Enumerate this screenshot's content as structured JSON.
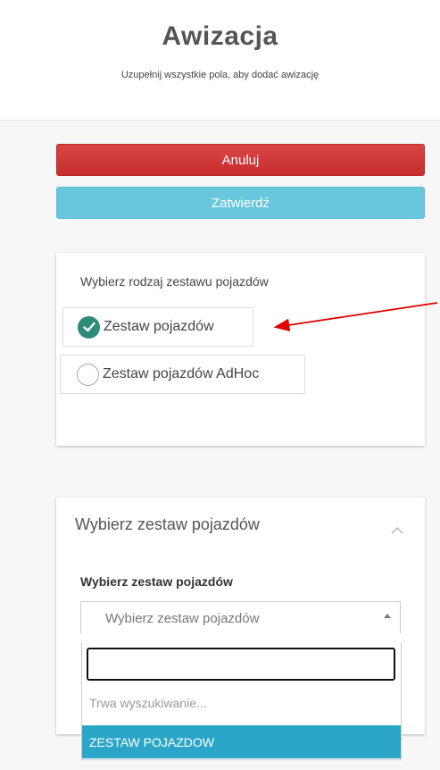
{
  "header": {
    "title": "Awizacja",
    "subtitle": "Uzupełnij wszystkie pola, aby dodać awizację"
  },
  "buttons": {
    "cancel_label": "Anuluj",
    "confirm_label": "Zatwierdź"
  },
  "vehicle_type": {
    "label": "Wybierz rodzaj zestawu pojazdów",
    "options": [
      {
        "label": "Zestaw pojazdów",
        "selected": true
      },
      {
        "label": "Zestaw pojazdów AdHoc",
        "selected": false
      }
    ]
  },
  "vehicle_set": {
    "panel_title": "Wybierz zestaw pojazdów",
    "field_label": "Wybierz zestaw pojazdów",
    "select_placeholder": "Wybierz zestaw pojazdów",
    "dropdown": {
      "search_value": "",
      "status_text": "Trwa wyszukiwanie...",
      "options": [
        "ZESTAW POJAZDOW"
      ]
    }
  },
  "colors": {
    "cancel": "#c72e2e",
    "confirm": "#68c7dc",
    "check": "#2e8b7a",
    "highlight": "#2ba6c9",
    "annotation_arrow": "#e00000"
  },
  "icons": [
    "check-icon",
    "chevron-up-icon",
    "caret-up-icon",
    "annotation-arrow"
  ]
}
